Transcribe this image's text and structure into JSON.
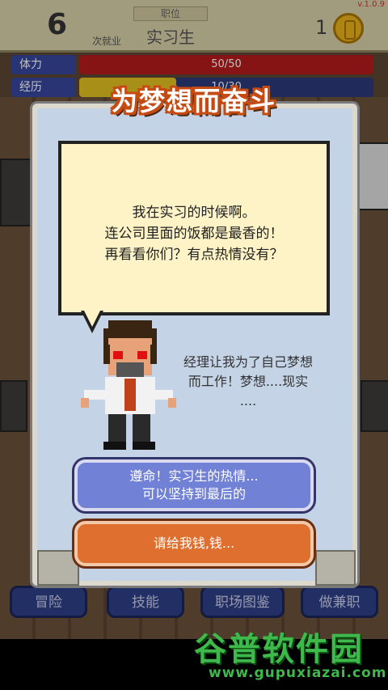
{
  "version": "v.1.0.9",
  "hud": {
    "job_count": "6",
    "job_count_label": "次就业",
    "position_label": "职位",
    "position_value": "实习生",
    "coins": "1"
  },
  "stats": [
    {
      "label": "体力",
      "text": "50/50",
      "fill": 1.0
    },
    {
      "label": "经历",
      "text": "10/30",
      "fill": 0.33
    }
  ],
  "dialog": {
    "title": "为梦想而奋斗",
    "speech_lines": [
      "我在实习的时候啊。",
      "连公司里面的饭都是最香的！",
      "再看看你们？有点热情没有？"
    ],
    "narration_lines": [
      "经理让我为了自己梦想",
      "而工作！梦想....现实",
      "...."
    ],
    "choice_a_lines": [
      "遵命！实习生的热情...",
      "可以坚持到最后的"
    ],
    "choice_b": "请给我钱,钱..."
  },
  "nav": [
    {
      "label": "冒险"
    },
    {
      "label": "技能"
    },
    {
      "label": "职场图鉴"
    },
    {
      "label": "做兼职"
    }
  ],
  "watermark": {
    "logo": "谷普软件园",
    "url": "www.gupuxiazai.com"
  },
  "colors": {
    "title_outline": "#c64b12",
    "choice_a": "#7081d6",
    "choice_b": "#de6f2e",
    "watermark": "#3fb84c"
  }
}
